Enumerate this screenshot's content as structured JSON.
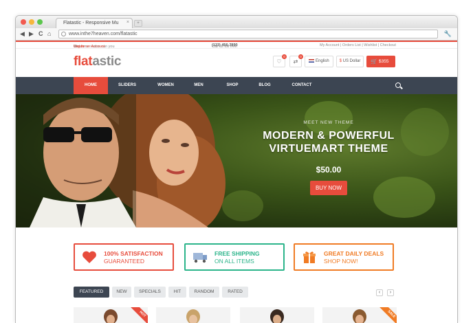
{
  "browser": {
    "tab_title": "Flatastic - Responsive Mu",
    "tab_close": "×",
    "new_tab": "+",
    "url": "www.inthe7heaven.com/flatastic",
    "nav_back": "◀",
    "nav_forward": "▶",
    "nav_reload": "C",
    "nav_home": "⌂",
    "wrench": "🔧",
    "dot_colors": [
      "#f25a4f",
      "#f6b73c",
      "#5bc64c"
    ]
  },
  "topbar": {
    "welcome": "Welcome visitor can you",
    "login": "Log In",
    "or": "or",
    "create": "Create an Account",
    "call": "Call us toll free:",
    "phone": "(123) 456-7890",
    "links": "My Account  |  Orders List  |  Wishlist  |  Checkout"
  },
  "header": {
    "logo_part1": "flat",
    "logo_part2": "astic",
    "wishlist_badge": "0",
    "compare_badge": "0",
    "language": "English",
    "currency_symbol": "$",
    "currency": "US Dollar",
    "cart_total": "$355"
  },
  "nav": {
    "items": [
      "HOME",
      "SLIDERS",
      "WOMEN",
      "MEN",
      "SHOP",
      "BLOG",
      "CONTACT"
    ]
  },
  "hero": {
    "eyebrow": "MEET NEW THEME",
    "title_line1": "MODERN & POWERFUL",
    "title_line2": "VIRTUEMART THEME",
    "price": "$50.00",
    "button": "BUY NOW"
  },
  "features": [
    {
      "line1": "100% SATISFACTION",
      "line2": "GUARANTEED",
      "color": "#e74c3c"
    },
    {
      "line1": "FREE SHIPPING",
      "line2": "ON ALL ITEMS",
      "color": "#2bb48a"
    },
    {
      "line1": "GREAT DAILY DEALS",
      "line2": "SHOP NOW!",
      "color": "#f07b24"
    }
  ],
  "product_tabs": [
    "FEATURED",
    "NEW",
    "SPECIALS",
    "HIT",
    "RANDOM",
    "RATED"
  ],
  "carousel": {
    "prev": "‹",
    "next": "›"
  },
  "ribbons": {
    "hot": "HOT",
    "sale": "SALE"
  },
  "colors": {
    "accent": "#e74c3c",
    "nav_bg": "#3c4552"
  }
}
